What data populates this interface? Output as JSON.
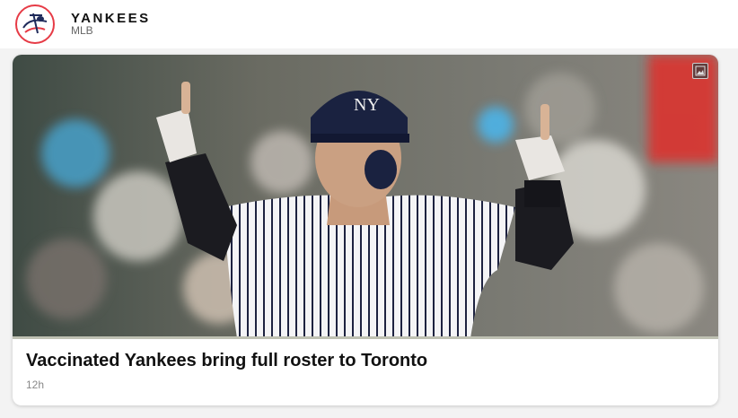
{
  "header": {
    "title": "YANKEES",
    "subtitle": "MLB",
    "logo_icon": "yankees-logo-icon"
  },
  "card": {
    "image_badge_icon": "image-icon",
    "headline": "Vaccinated Yankees bring full roster to Toronto",
    "time": "12h"
  },
  "colors": {
    "accent": "#e63b46",
    "background": "#f3f3f3",
    "card": "#ffffff"
  }
}
